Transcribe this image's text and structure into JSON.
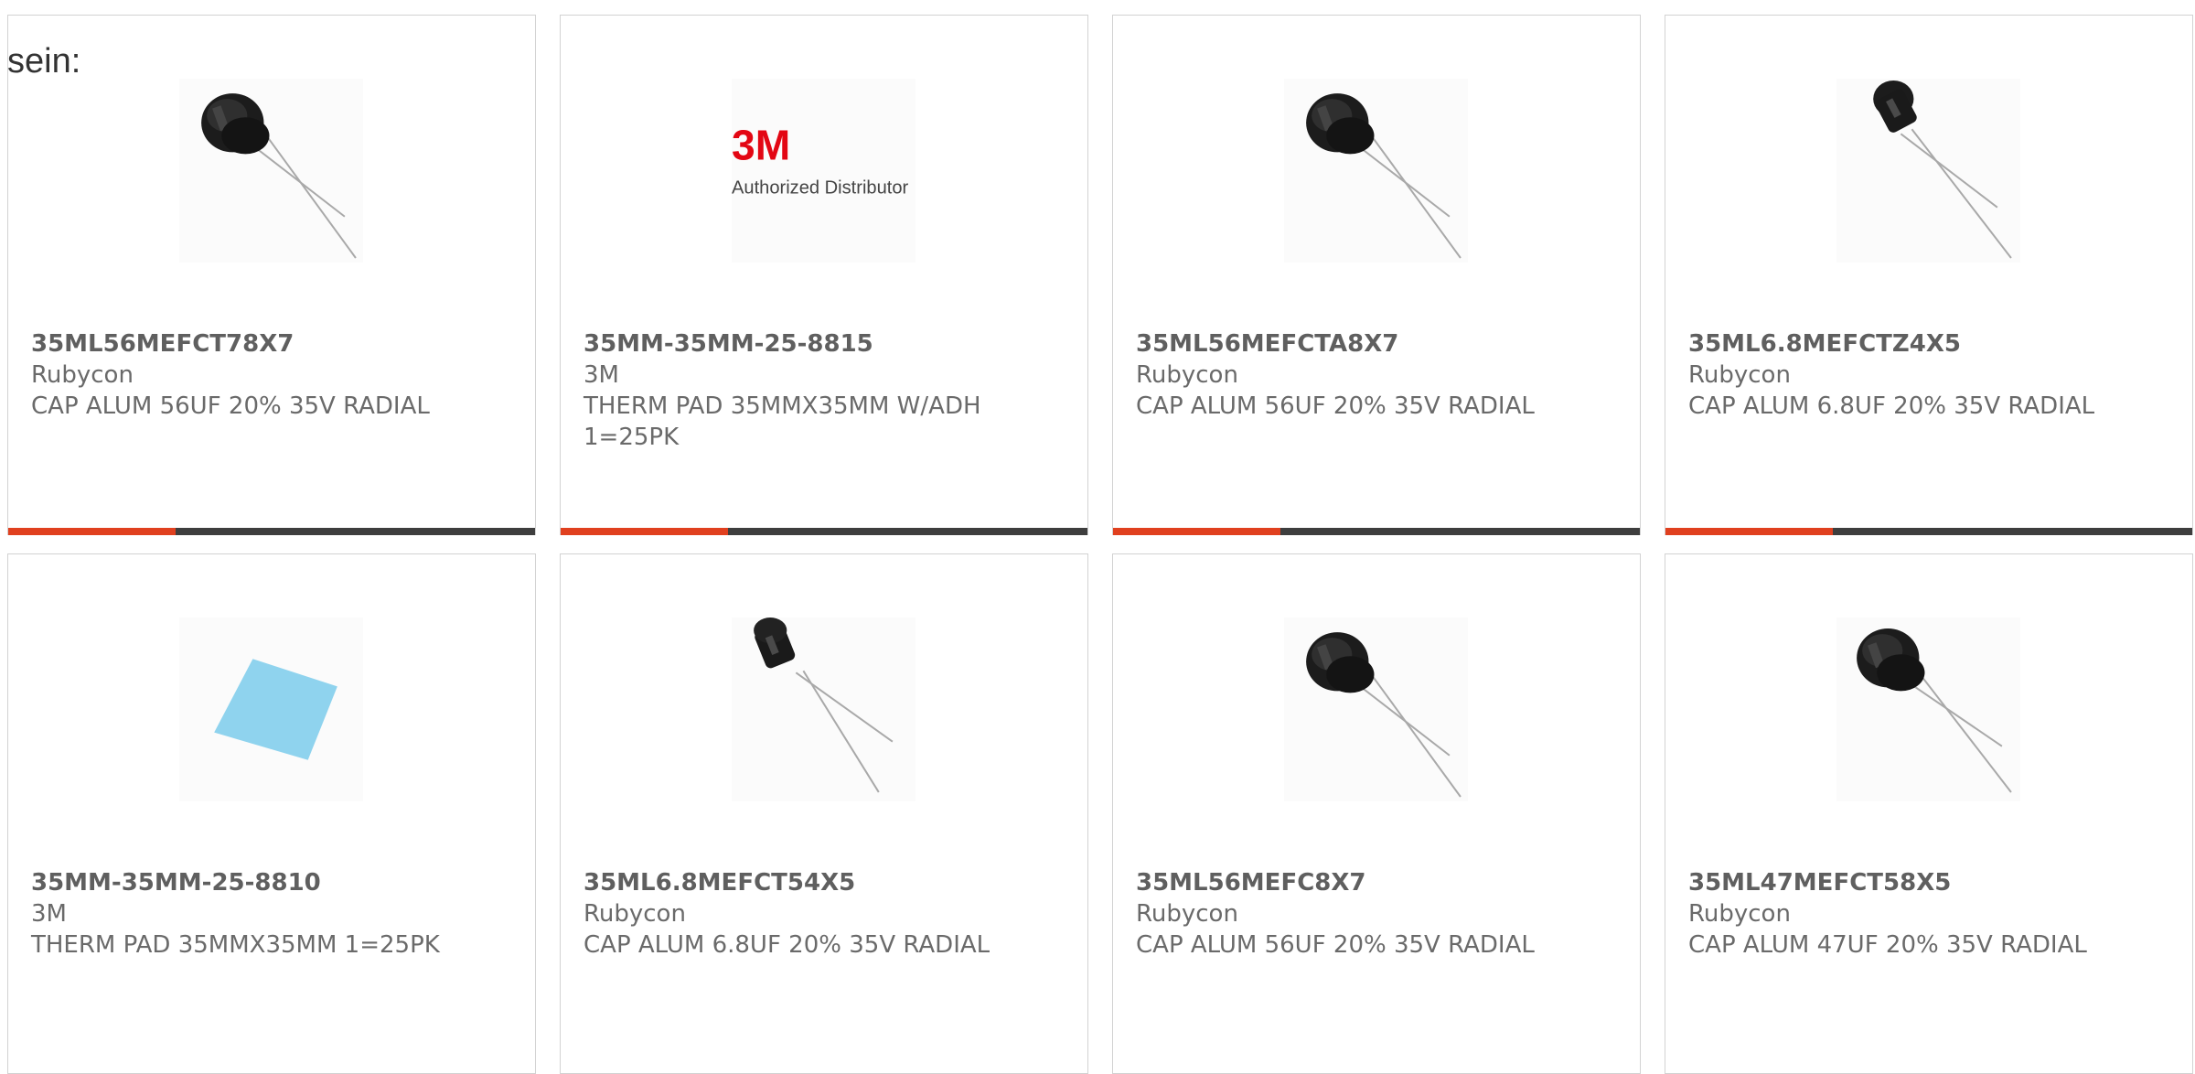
{
  "lead_text": "sein:",
  "colors": {
    "accent": "#e0401f",
    "bar": "#3e3e3e",
    "border": "#d2d2d2",
    "text": "#666666"
  },
  "products": [
    {
      "part": "35ML56MEFCT78X7",
      "maker": "Rubycon",
      "desc": "CAP ALUM 56UF 20% 35V RADIAL",
      "icon": "capacitor-icon"
    },
    {
      "part": "35MM-35MM-25-8815",
      "maker": "3M",
      "desc": "THERM PAD 35MMX35MM W/ADH 1=25PK",
      "icon": "3m-logo",
      "logo_text": "3M",
      "logo_subtext": "Authorized Distributor"
    },
    {
      "part": "35ML56MEFCTA8X7",
      "maker": "Rubycon",
      "desc": "CAP ALUM 56UF 20% 35V RADIAL",
      "icon": "capacitor-icon"
    },
    {
      "part": "35ML6.8MEFCTZ4X5",
      "maker": "Rubycon",
      "desc": "CAP ALUM 6.8UF 20% 35V RADIAL",
      "icon": "capacitor-icon"
    },
    {
      "part": "35MM-35MM-25-8810",
      "maker": "3M",
      "desc": "THERM PAD 35MMX35MM 1=25PK",
      "icon": "thermal-pad-icon"
    },
    {
      "part": "35ML6.8MEFCT54X5",
      "maker": "Rubycon",
      "desc": "CAP ALUM 6.8UF 20% 35V RADIAL",
      "icon": "capacitor-icon"
    },
    {
      "part": "35ML56MEFC8X7",
      "maker": "Rubycon",
      "desc": "CAP ALUM 56UF 20% 35V RADIAL",
      "icon": "capacitor-icon"
    },
    {
      "part": "35ML47MEFCT58X5",
      "maker": "Rubycon",
      "desc": "CAP ALUM 47UF 20% 35V RADIAL",
      "icon": "capacitor-icon"
    }
  ]
}
